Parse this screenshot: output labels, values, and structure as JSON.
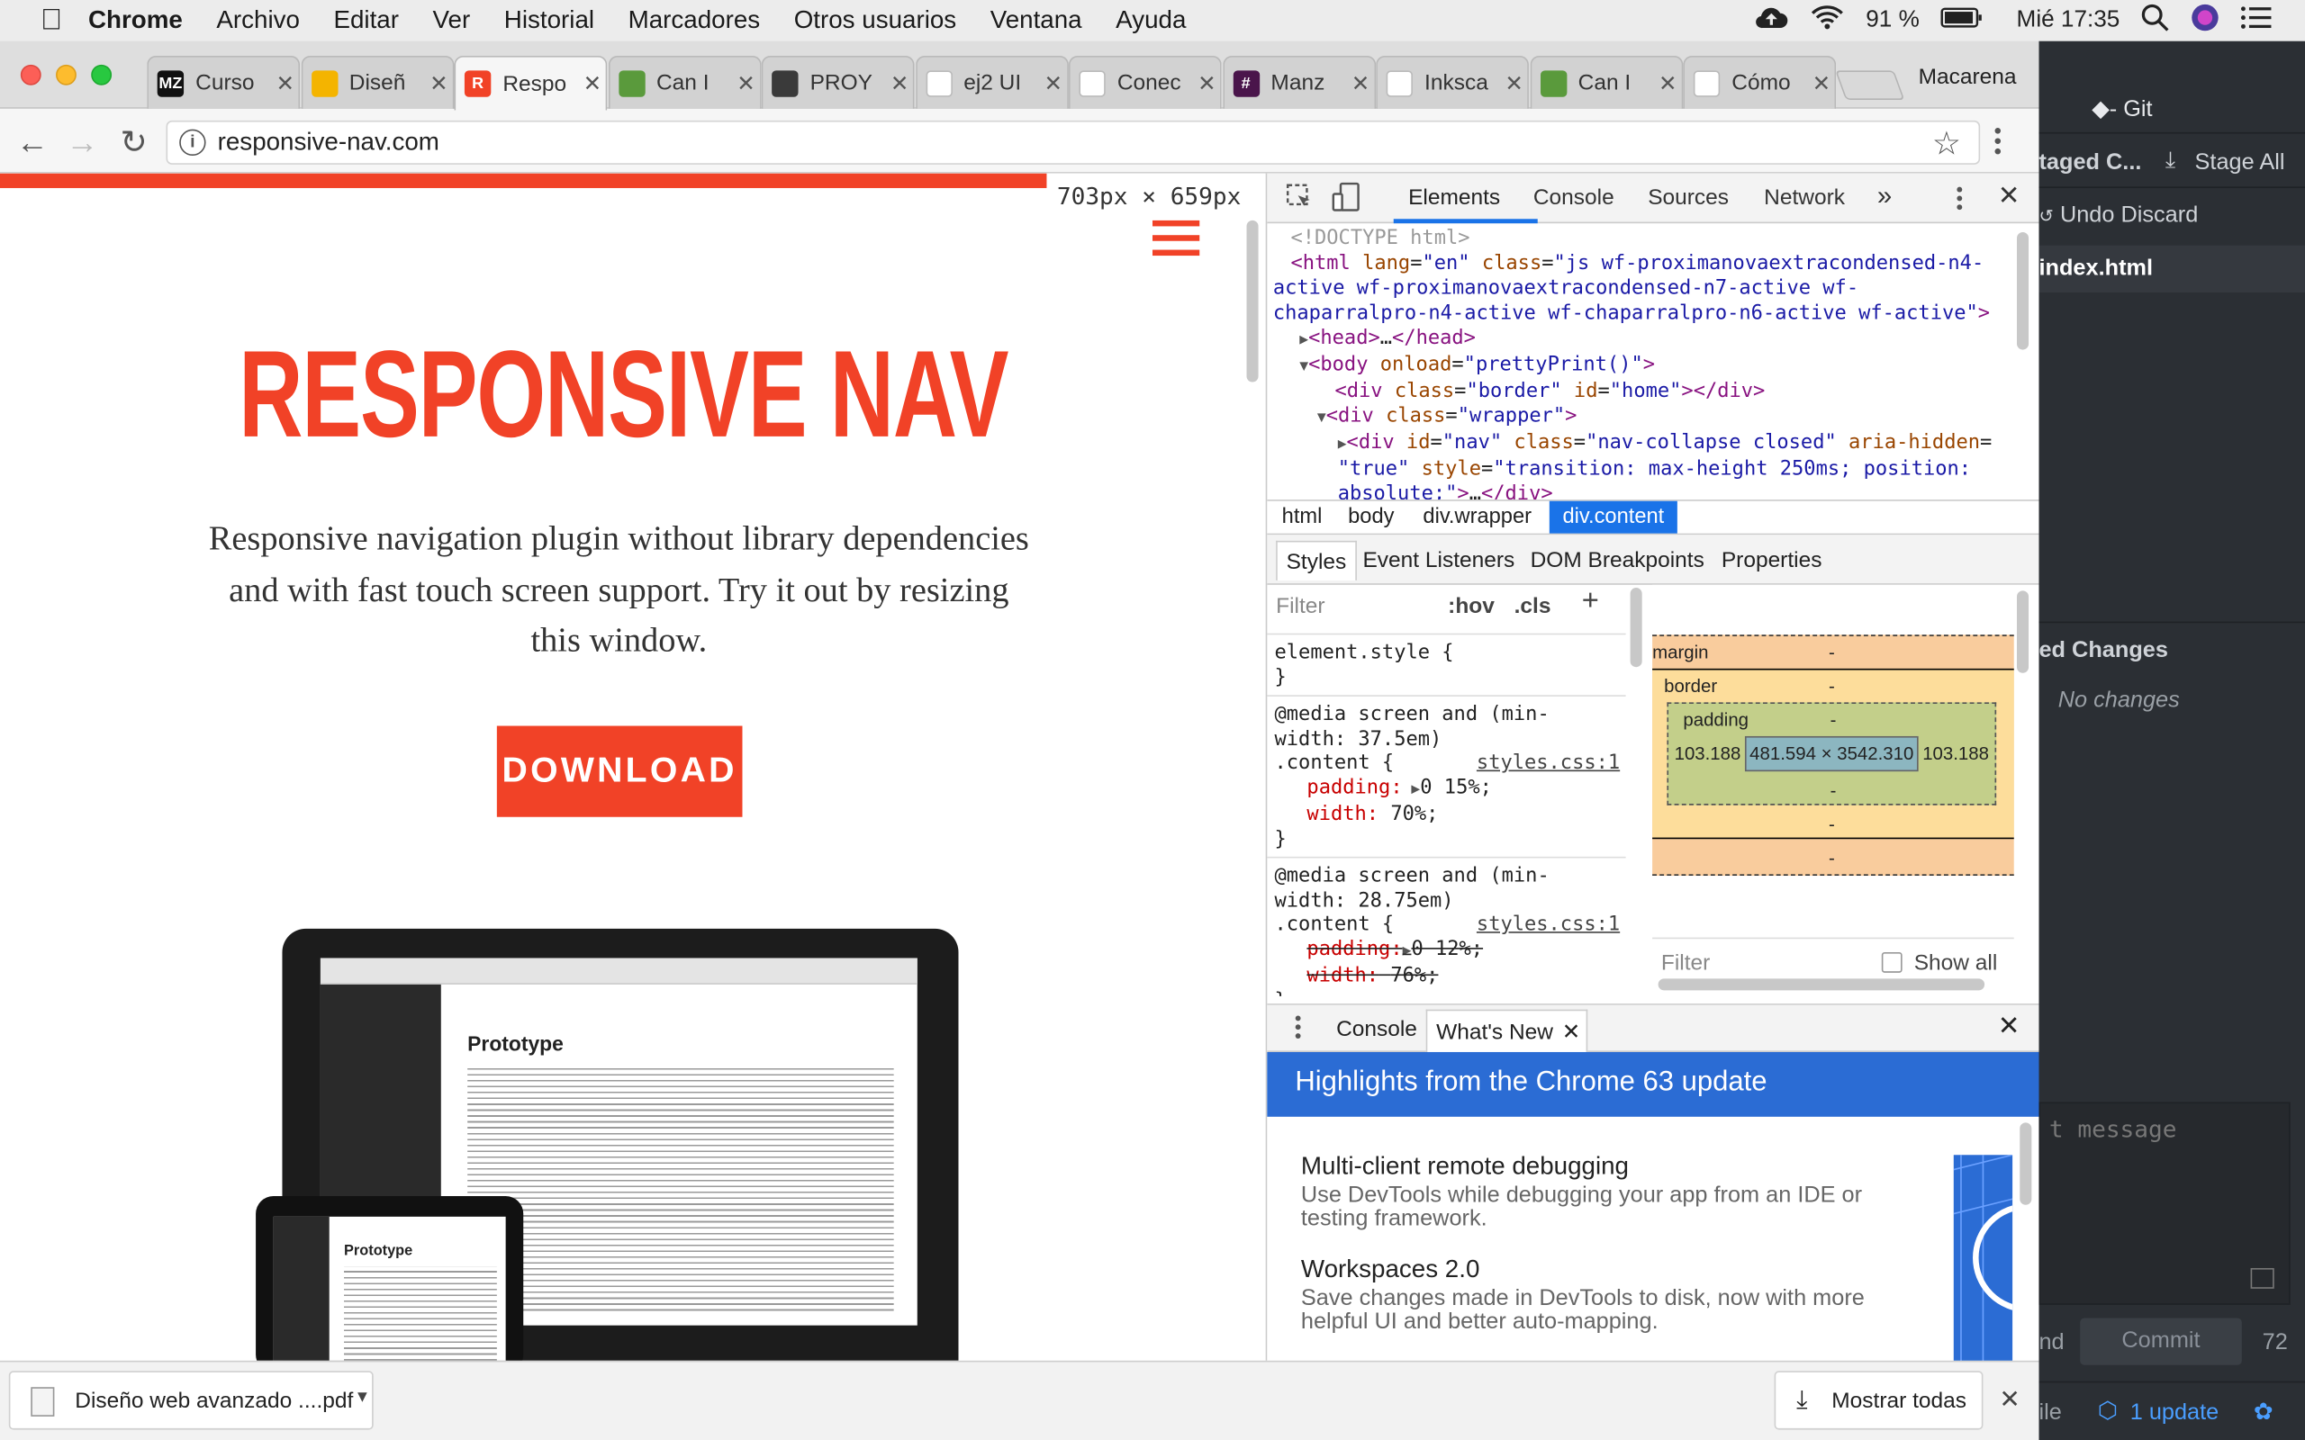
{
  "menubar": {
    "app": "Chrome",
    "items": [
      "Archivo",
      "Editar",
      "Ver",
      "Historial",
      "Marcadores",
      "Otros usuarios",
      "Ventana",
      "Ayuda"
    ],
    "battery": "91 %",
    "clock": "Mié 17:35"
  },
  "tabs": [
    {
      "title": "Curso",
      "fav": "MZ",
      "color": "#111111"
    },
    {
      "title": "Diseñ",
      "fav": "",
      "color": "#f4b400"
    },
    {
      "title": "Respo",
      "fav": "R",
      "color": "#f14227"
    },
    {
      "title": "Can I",
      "fav": "",
      "color": "#5a9a3c"
    },
    {
      "title": "PROY",
      "fav": "",
      "color": "#3a3a3a"
    },
    {
      "title": "ej2 UI",
      "fav": "",
      "color": "#ffffff"
    },
    {
      "title": "Conec",
      "fav": "",
      "color": "#ffffff"
    },
    {
      "title": "Manz",
      "fav": "#",
      "color": "#4a154b"
    },
    {
      "title": "Inksca",
      "fav": "",
      "color": "#ffffff"
    },
    {
      "title": "Can I",
      "fav": "",
      "color": "#5a9a3c"
    },
    {
      "title": "Cómo",
      "fav": "",
      "color": "#ffffff"
    }
  ],
  "profile": "Macarena",
  "omnibox": {
    "url": "responsive-nav.com"
  },
  "page": {
    "dims": "703px × 659px",
    "title": "RESPONSIVE NAV",
    "lede": "Responsive navigation plugin without library dependencies and with fast touch screen support. Try it out by resizing this window.",
    "download": "DOWNLOAD",
    "proto": "Prototype"
  },
  "devtools": {
    "tabs": [
      "Elements",
      "Console",
      "Sources",
      "Network"
    ],
    "more": "»",
    "crumbs": [
      "html",
      "body",
      "div.wrapper",
      "div.content"
    ],
    "panes": [
      "Styles",
      "Event Listeners",
      "DOM Breakpoints",
      "Properties"
    ],
    "filter": "Filter",
    "hov": ":hov",
    "cls": ".cls",
    "element_style": "element.style {",
    "close_brace": "}",
    "rule1_media": "@media screen and (min-width: 37.5em)",
    "rule1_sel": ".content {",
    "rule1_src": "styles.css:1",
    "rule1_p1": "padding:",
    "rule1_v1": "0 15%;",
    "rule1_p2": "width:",
    "rule1_v2": "70%;",
    "rule2_media": "@media screen and (min-width: 28.75em)",
    "rule2_sel": ".content {",
    "rule2_src": "styles.css:1",
    "rule2_p1": "padding:",
    "rule2_v1": "0 12%;",
    "rule2_p2": "width:",
    "rule2_v2": "76%;",
    "box": {
      "margin": "margin",
      "border": "border",
      "padding": "padding",
      "dash": "-",
      "left": "103.188",
      "right": "103.188",
      "size": "481.594 × 3542.310"
    },
    "computed_filter": "Filter",
    "show_all": "Show all",
    "drawer": {
      "tab1": "Console",
      "tab2": "What's New",
      "banner": "Highlights from the Chrome 63 update",
      "h1": "Multi-client remote debugging",
      "p1": "Use DevTools while debugging your app from an IDE or testing framework.",
      "h2": "Workspaces 2.0",
      "p2": "Save changes made in DevTools to disk, now with more helpful UI and better auto-mapping."
    }
  },
  "git": {
    "title": "Git",
    "staged": "taged C...",
    "stage_all": "Stage All",
    "undo": "Undo Discard",
    "file": "index.html",
    "changes": "ed Changes",
    "no_changes": "No changes",
    "commit_ph": "t message",
    "nd": "nd",
    "commit": "Commit",
    "count": "72",
    "ile": "ile",
    "update": "1 update"
  },
  "downloads": {
    "file": "Diseño web avanzado ....pdf",
    "show_all": "Mostrar todas"
  }
}
